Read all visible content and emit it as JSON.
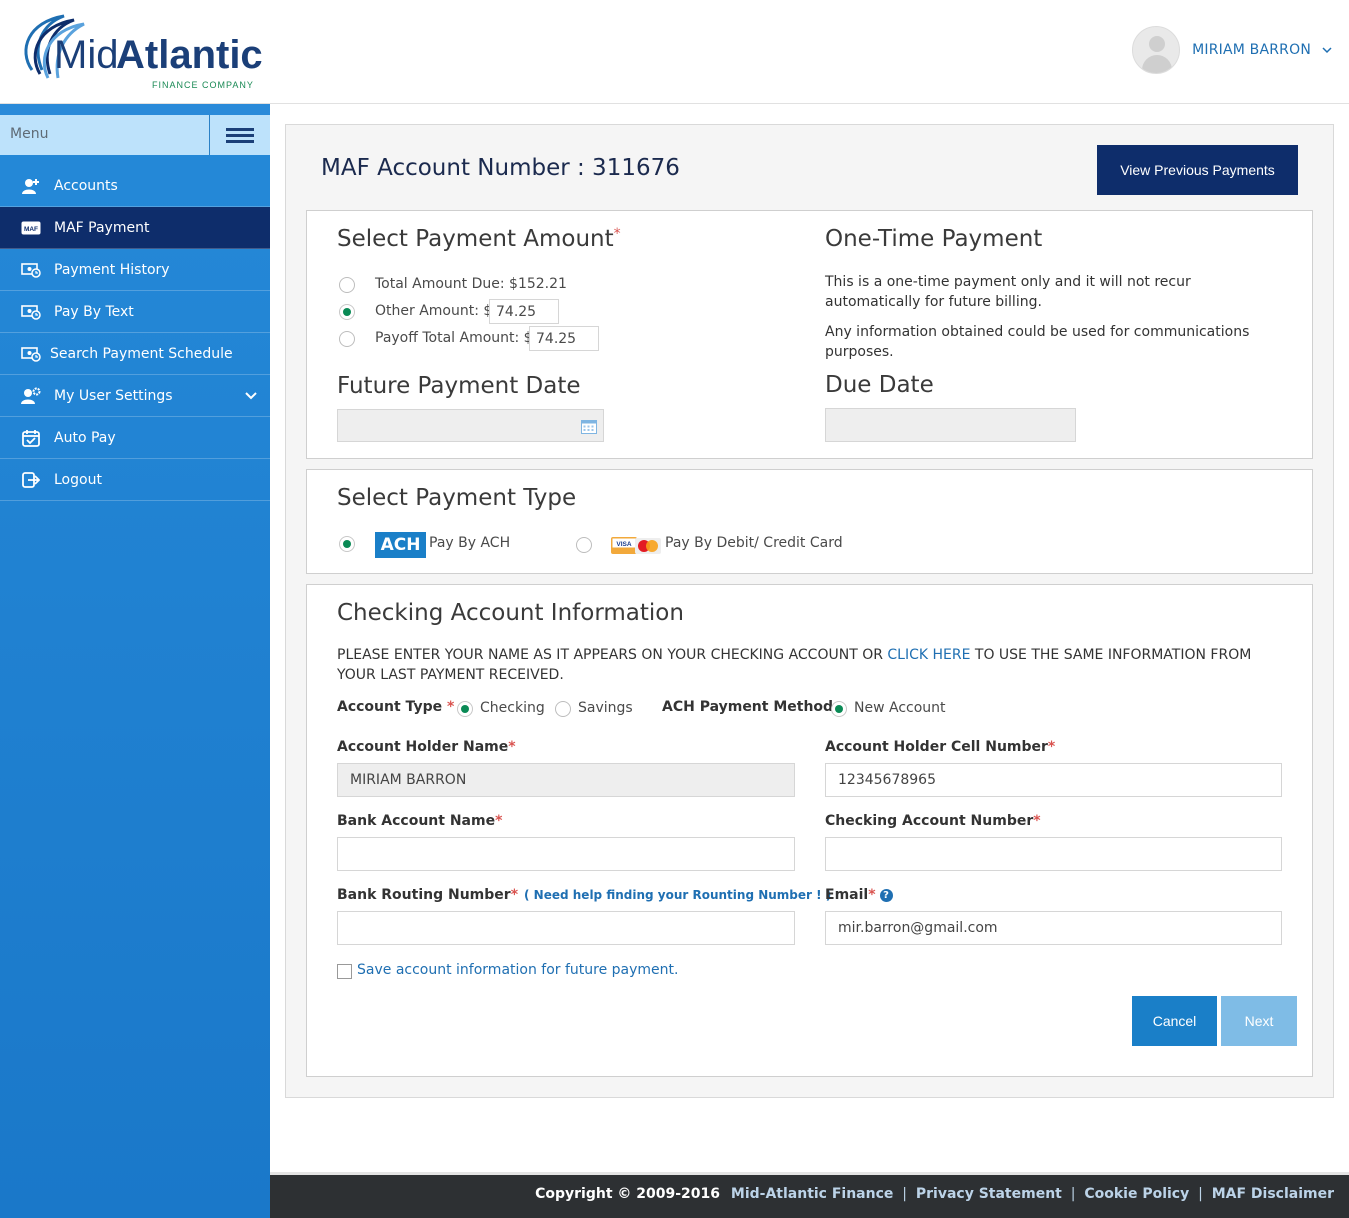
{
  "header": {
    "logo_mid": "Mid",
    "logo_atlantic": "Atlantic",
    "logo_sub": "FINANCE COMPANY",
    "user_name": "MIRIAM BARRON"
  },
  "sidebar": {
    "menu_label": "Menu",
    "items": [
      {
        "label": "Accounts",
        "icon": "user-plus-icon",
        "active": false
      },
      {
        "label": "MAF Payment",
        "icon": "maf-card-icon",
        "active": true
      },
      {
        "label": "Payment History",
        "icon": "money-clock-icon",
        "active": false
      },
      {
        "label": "Pay By Text",
        "icon": "money-clock-icon",
        "active": false
      },
      {
        "label": "Search Payment Schedule",
        "icon": "money-clock-icon",
        "active": false
      },
      {
        "label": "My User Settings",
        "icon": "user-gear-icon",
        "active": false
      },
      {
        "label": "Auto Pay",
        "icon": "calendar-check-icon",
        "active": false
      },
      {
        "label": "Logout",
        "icon": "logout-icon",
        "active": false
      }
    ],
    "maf_badge": "MAF"
  },
  "main": {
    "account_title": "MAF Account Number : 311676",
    "view_previous_label": "View Previous Payments"
  },
  "amount": {
    "title": "Select Payment Amount",
    "req": "*",
    "total_due_label": "Total Amount Due: $152.21",
    "other_label": "Other Amount: $",
    "other_value": "74.25",
    "payoff_label": "Payoff Total Amount: $",
    "payoff_value": "74.25",
    "future_title": "Future Payment Date",
    "one_time_title": "One-Time Payment",
    "one_time_p1": "This is a one-time payment only and it will not recur automatically for future billing.",
    "one_time_p2": "Any information obtained could be used for communications purposes.",
    "due_title": "Due Date"
  },
  "ptype": {
    "title": "Select Payment Type",
    "ach_badge": "ACH",
    "ach_label": "Pay By ACH",
    "card_label": "Pay By Debit/ Credit Card"
  },
  "checking": {
    "title": "Checking Account Information",
    "instr_pre": "PLEASE ENTER YOUR NAME AS IT APPEARS ON YOUR CHECKING ACCOUNT OR ",
    "instr_link": "CLICK HERE",
    "instr_post": " TO USE THE SAME INFORMATION FROM YOUR LAST PAYMENT RECEIVED.",
    "account_type_label": "Account Type",
    "req": "*",
    "checking_label": "Checking",
    "savings_label": "Savings",
    "ach_method_label": "ACH Payment Method",
    "new_account_label": "New Account",
    "holder_name_label": "Account Holder Name",
    "holder_name_value": "MIRIAM BARRON",
    "cell_label": "Account Holder Cell Number",
    "cell_value": "12345678965",
    "bank_name_label": "Bank Account Name",
    "bank_name_value": "",
    "checking_num_label": "Checking Account Number",
    "checking_num_value": "",
    "routing_label": "Bank Routing Number",
    "routing_help": "( Need help finding your Rounting Number ! )",
    "routing_value": "",
    "email_label": "Email",
    "email_help": "?",
    "email_value": "mir.barron@gmail.com",
    "save_label": "Save account information for future payment.",
    "cancel_label": "Cancel",
    "next_label": "Next"
  },
  "footer": {
    "copyright": "Copyright © 2009-2016",
    "company_link": "Mid-Atlantic Finance",
    "sep": "|",
    "privacy": "Privacy Statement",
    "cookie": "Cookie Policy",
    "disclaimer": "MAF Disclaimer"
  },
  "colors": {
    "primary_blue": "#1a7fc8",
    "navy": "#0e2d6b",
    "radio_green": "#0a8a55"
  }
}
